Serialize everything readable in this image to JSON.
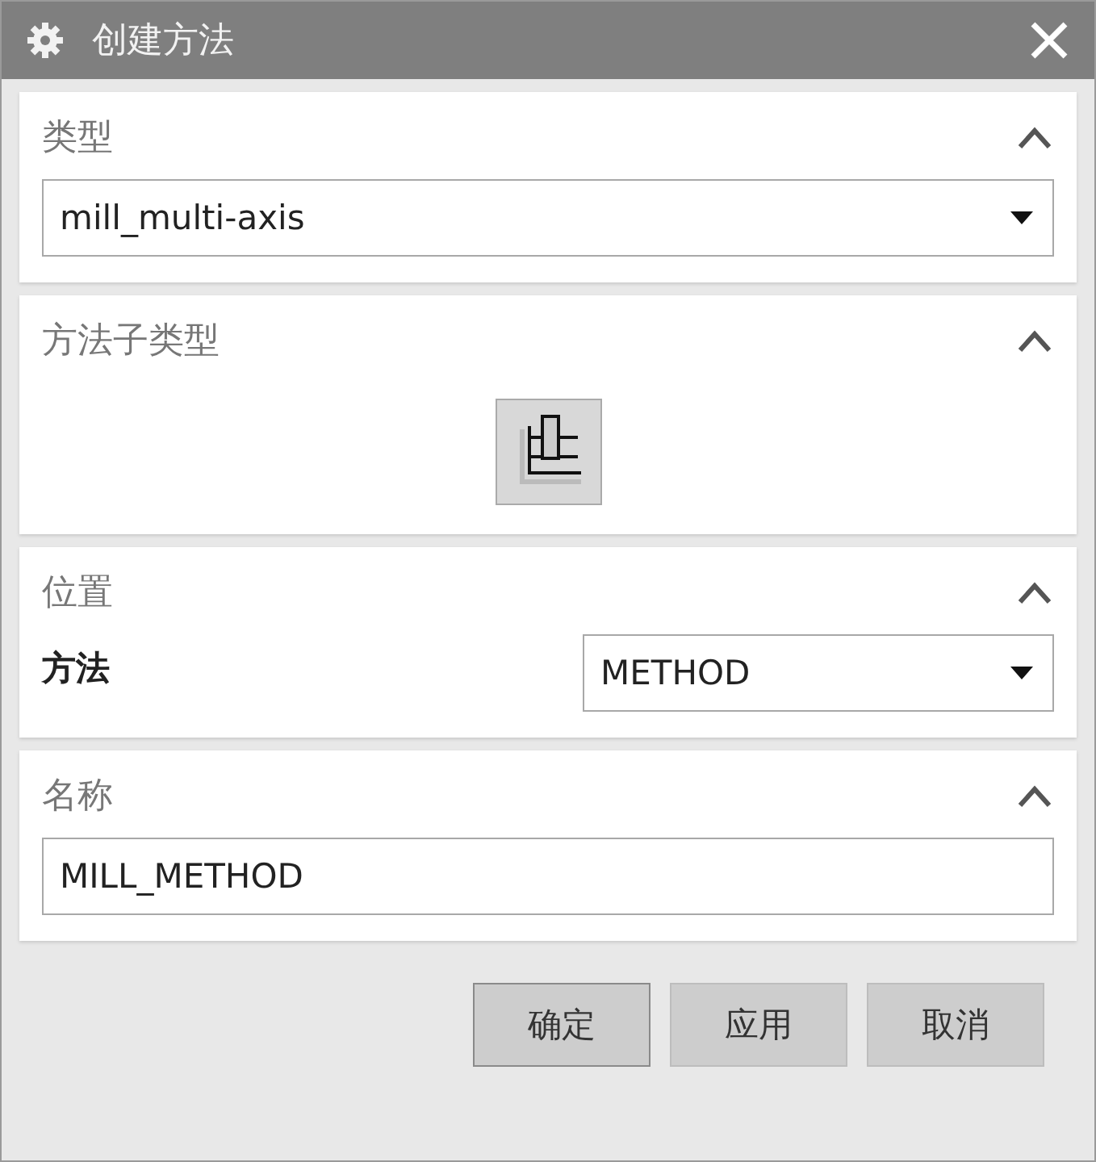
{
  "window": {
    "title": "创建方法"
  },
  "sections": [
    {
      "kind": "dropdown",
      "title": "类型",
      "expanded": true,
      "value": "mill_multi-axis"
    },
    {
      "kind": "icons",
      "title": "方法子类型",
      "expanded": true,
      "items": [
        {
          "selected": true
        }
      ]
    },
    {
      "kind": "labeled-dropdown",
      "title": "位置",
      "expanded": true,
      "label": "方法",
      "value": "METHOD"
    },
    {
      "kind": "text",
      "title": "名称",
      "expanded": true,
      "value": "MILL_METHOD"
    }
  ],
  "buttons": [
    {
      "label": "确定",
      "default": true
    },
    {
      "label": "应用",
      "default": false
    },
    {
      "label": "取消",
      "default": false
    }
  ]
}
